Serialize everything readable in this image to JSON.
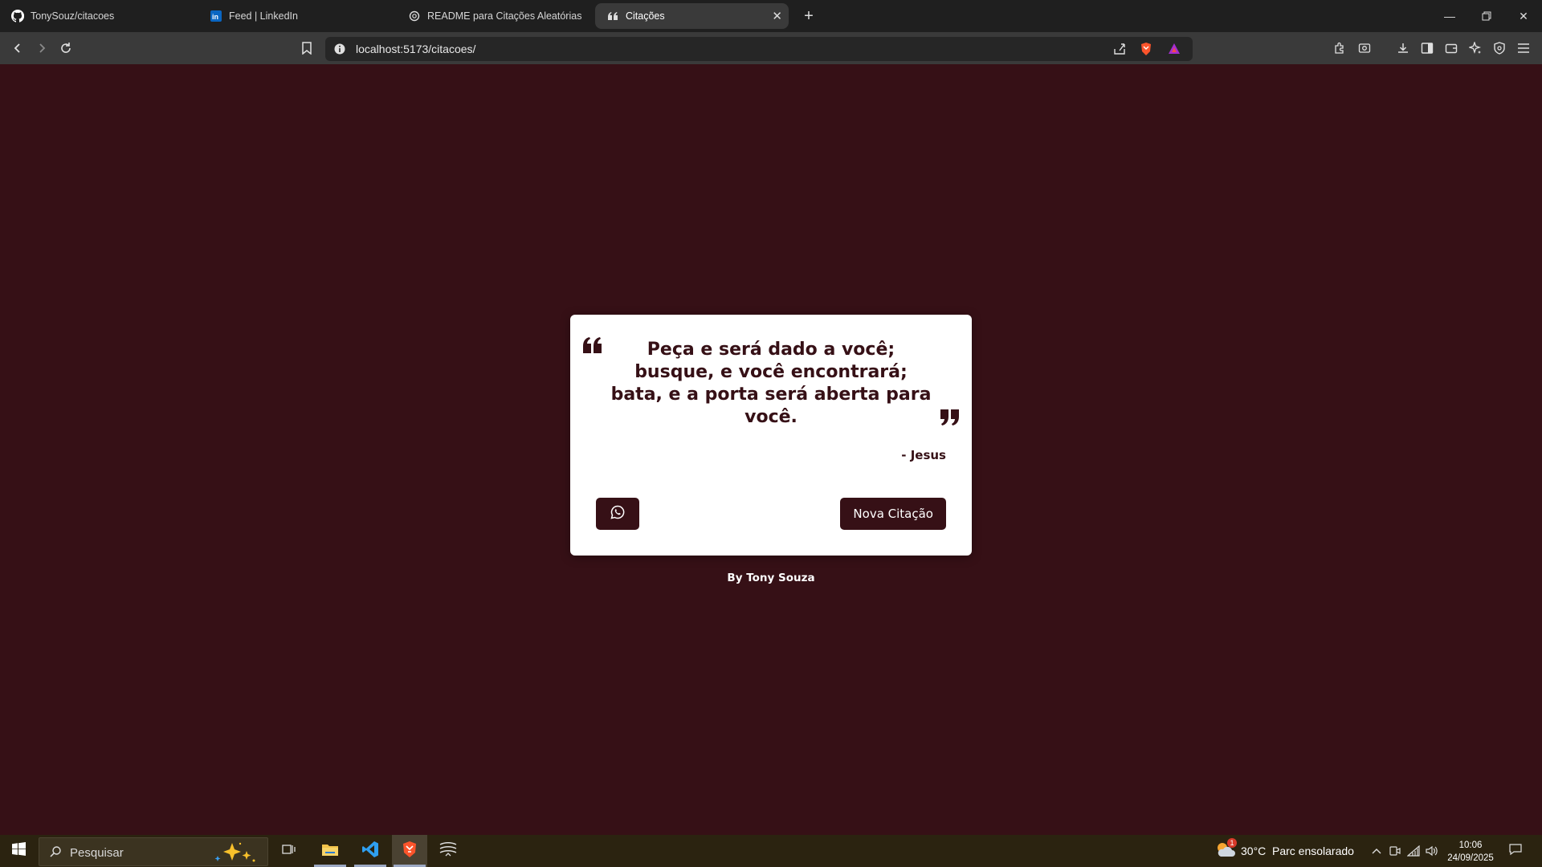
{
  "browser": {
    "tabs": [
      {
        "title": "TonySouz/citacoes",
        "icon": "github-icon"
      },
      {
        "title": "Feed | LinkedIn",
        "icon": "linkedin-icon"
      },
      {
        "title": "README para Citações Aleatórias",
        "icon": "openai-icon"
      },
      {
        "title": "Citações",
        "icon": "quote-icon",
        "active": true
      }
    ],
    "url": "localhost:5173/citacoes/"
  },
  "page": {
    "quote": "Peça e será dado a você; busque, e você encontrará; bata, e a porta será aberta para você.",
    "author": "- Jesus",
    "new_quote_label": "Nova Citação",
    "byline": "By Tony Souza",
    "colors": {
      "background": "#361016",
      "card": "#ffffff",
      "accent": "#361016"
    }
  },
  "taskbar": {
    "search_placeholder": "Pesquisar",
    "weather_temp": "30°C",
    "weather_desc": "Parc ensolarado",
    "weather_badge": "1",
    "time": "10:06",
    "date": "24/09/2025"
  }
}
